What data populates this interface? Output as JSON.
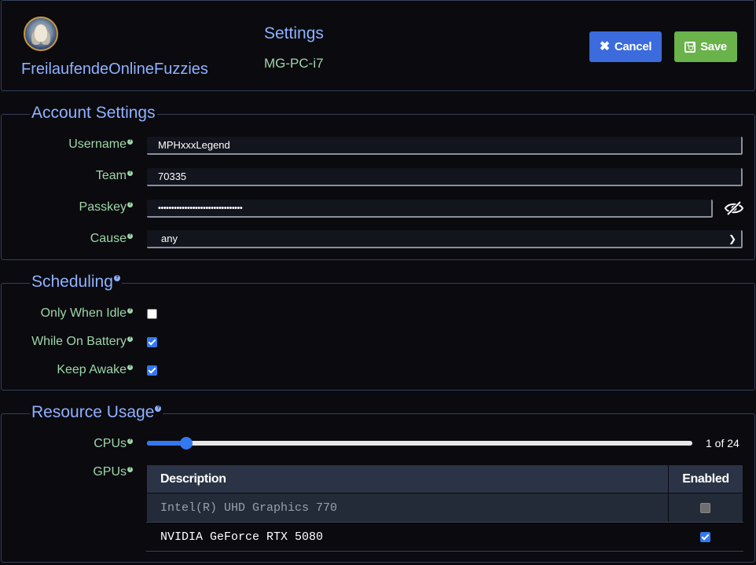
{
  "header": {
    "team_name": "FreilaufendeOnlineFuzzies",
    "title": "Settings",
    "machine": "MG-PC-i7",
    "cancel_label": "Cancel",
    "save_label": "Save"
  },
  "account": {
    "legend": "Account Settings",
    "username_label": "Username",
    "username_value": "MPHxxxLegend",
    "team_label": "Team",
    "team_value": "70335",
    "passkey_label": "Passkey",
    "passkey_value": "••••••••••••••••••••••••••••••••",
    "cause_label": "Cause",
    "cause_value": "any"
  },
  "scheduling": {
    "legend": "Scheduling",
    "options": [
      {
        "label": "Only When Idle",
        "checked": false
      },
      {
        "label": "While On Battery",
        "checked": true
      },
      {
        "label": "Keep Awake",
        "checked": true
      }
    ]
  },
  "resources": {
    "legend": "Resource Usage",
    "cpus_label": "CPUs",
    "cpus_value": 1,
    "cpus_max": 24,
    "cpus_readout": "1 of 24",
    "gpus_label": "GPUs",
    "table": {
      "col_description": "Description",
      "col_enabled": "Enabled",
      "rows": [
        {
          "description": "Intel(R) UHD Graphics 770",
          "enabled": false,
          "disabled": true
        },
        {
          "description": "NVIDIA GeForce RTX 5080",
          "enabled": true,
          "disabled": false
        }
      ]
    }
  },
  "colors": {
    "accent_blue": "#8fb2ff",
    "label_green": "#9fd6a8",
    "cancel_button": "#3b6bdc",
    "save_button": "#6ab24a",
    "checkbox_blue": "#3478f0"
  },
  "icons": {
    "cancel": "x-icon",
    "save": "floppy-disk-icon",
    "passkey_toggle": "eye-slash-icon",
    "help": "question-circle-icon",
    "select": "chevron-down-icon"
  }
}
